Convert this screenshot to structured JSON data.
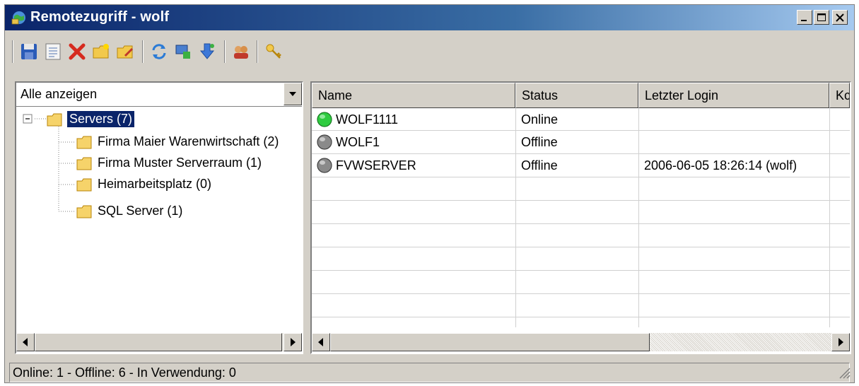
{
  "window": {
    "title": "Remotezugriff - wolf"
  },
  "filter": {
    "selected": "Alle anzeigen"
  },
  "tree": {
    "root": "Servers (7)",
    "children": [
      "Firma Maier Warenwirtschaft (2)",
      "Firma Muster Serverraum (1)",
      "Heimarbeitsplatz (0)",
      "SQL Server (1)"
    ]
  },
  "list": {
    "columns": [
      "Name",
      "Status",
      "Letzter Login",
      "Kc"
    ],
    "rows": [
      {
        "name": "WOLF1111",
        "status": "Online",
        "login": "",
        "indicator": "green"
      },
      {
        "name": "WOLF1",
        "status": "Offline",
        "login": "",
        "indicator": "gray"
      },
      {
        "name": "FVWSERVER",
        "status": "Offline",
        "login": "2006-06-05 18:26:14 (wolf)",
        "indicator": "gray"
      }
    ]
  },
  "status_bar": {
    "text": "Online: 1 - Offline: 6 - In Verwendung: 0"
  },
  "toolbar": {
    "icons": [
      "save-icon",
      "properties-icon",
      "delete-icon",
      "new-folder-icon",
      "edit-folder-icon",
      "refresh-icon",
      "connect-icon",
      "import-icon",
      "users-icon",
      "keys-icon"
    ]
  },
  "colors": {
    "title_start": "#0a246a",
    "title_end": "#a6caf0",
    "online": "#2ecc40",
    "offline": "#808080",
    "selection": "#0a246a"
  }
}
